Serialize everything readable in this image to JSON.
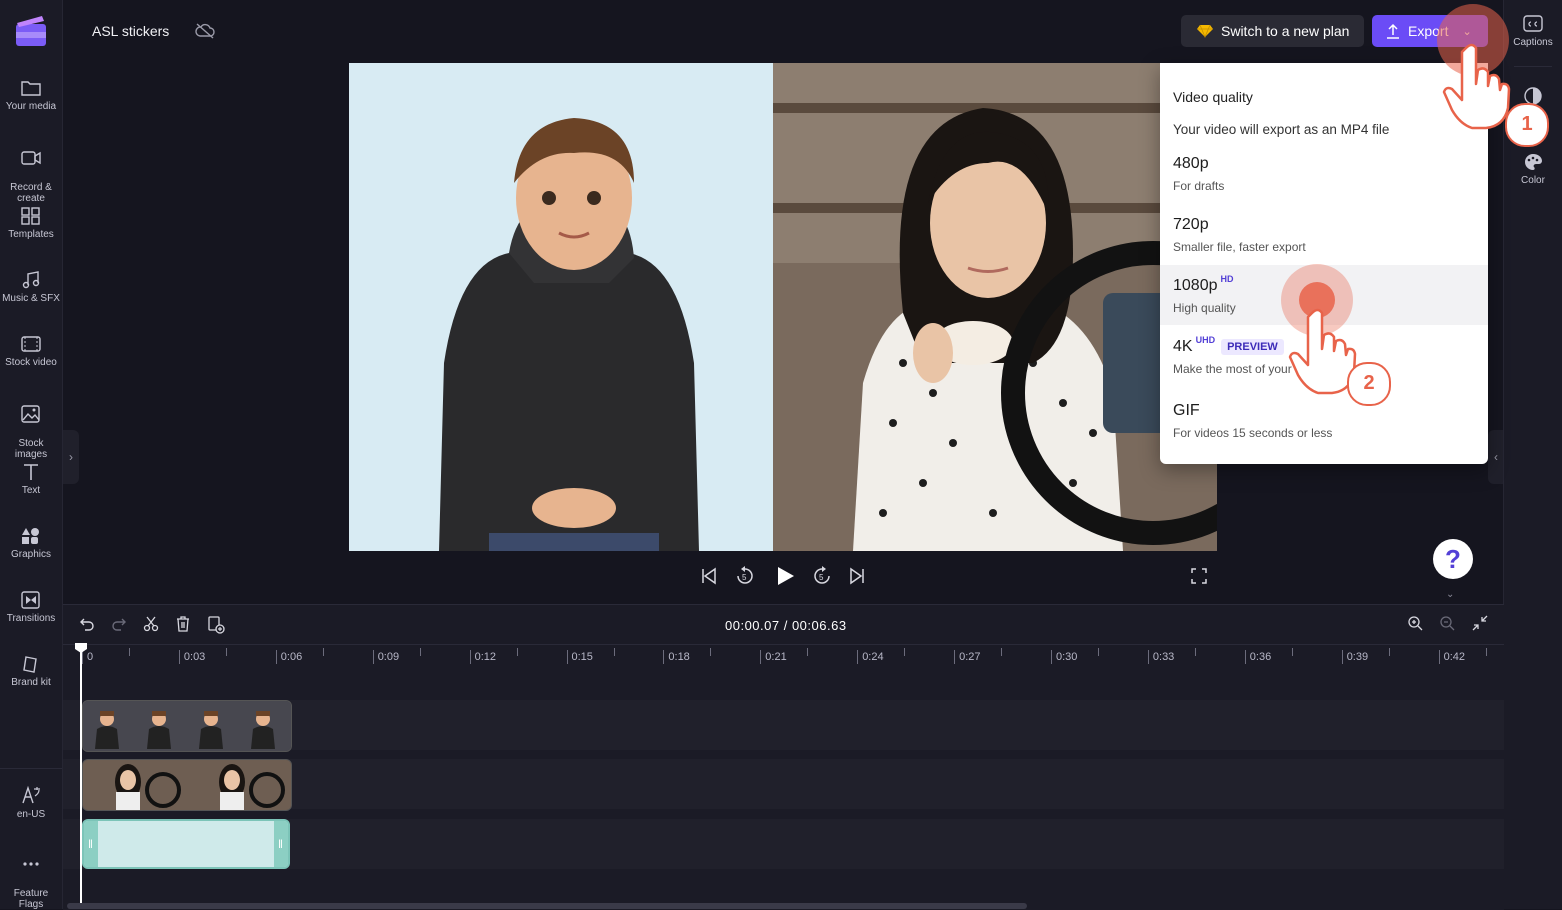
{
  "header": {
    "project_title": "ASL stickers",
    "switch_plan_label": "Switch to a new plan",
    "export_label": "Export"
  },
  "left_sidebar": {
    "items": [
      {
        "label": "Your media",
        "icon": "folder-icon"
      },
      {
        "label": "Record &\ncreate",
        "icon": "camera-icon"
      },
      {
        "label": "Templates",
        "icon": "templates-icon"
      },
      {
        "label": "Music & SFX",
        "icon": "music-icon"
      },
      {
        "label": "Stock video",
        "icon": "film-icon"
      },
      {
        "label": "Stock\nimages",
        "icon": "image-icon"
      },
      {
        "label": "Text",
        "icon": "text-icon"
      },
      {
        "label": "Graphics",
        "icon": "shapes-icon"
      },
      {
        "label": "Transitions",
        "icon": "transitions-icon"
      },
      {
        "label": "Brand kit",
        "icon": "brand-kit-icon"
      }
    ],
    "bottom_items": [
      {
        "label": "en-US",
        "icon": "language-icon"
      },
      {
        "label": "Feature\nFlags",
        "icon": "more-icon"
      }
    ]
  },
  "right_sidebar": {
    "items": [
      {
        "label": "Captions",
        "icon": "captions-icon"
      },
      {
        "label": "Color",
        "icon": "palette-icon"
      }
    ]
  },
  "export_menu": {
    "heading": "Video quality",
    "subheading": "Your video will export as an MP4 file",
    "options": [
      {
        "title": "480p",
        "sup": "",
        "badge": "",
        "subtitle": "For drafts"
      },
      {
        "title": "720p",
        "sup": "",
        "badge": "",
        "subtitle": "Smaller file, faster export"
      },
      {
        "title": "1080p",
        "sup": "HD",
        "badge": "",
        "subtitle": "High quality"
      },
      {
        "title": "4K",
        "sup": "UHD",
        "badge": "PREVIEW",
        "subtitle": "Make the most of your 4"
      },
      {
        "title": "GIF",
        "sup": "",
        "badge": "",
        "subtitle": "For videos 15 seconds or less"
      }
    ]
  },
  "timeline": {
    "current_time": "00:00.07",
    "separator": " / ",
    "total_time": "00:06.63",
    "ticks": [
      "0",
      "0:03",
      "0:06",
      "0:09",
      "0:12",
      "0:15",
      "0:18",
      "0:21",
      "0:24",
      "0:27",
      "0:30",
      "0:33",
      "0:36",
      "0:39",
      "0:42"
    ]
  },
  "help": {
    "label": "?"
  },
  "steps": [
    "1",
    "2"
  ],
  "colors": {
    "accent": "#6b4cf6",
    "annotation": "#e8634a",
    "text_clip": "#cfeaea"
  }
}
